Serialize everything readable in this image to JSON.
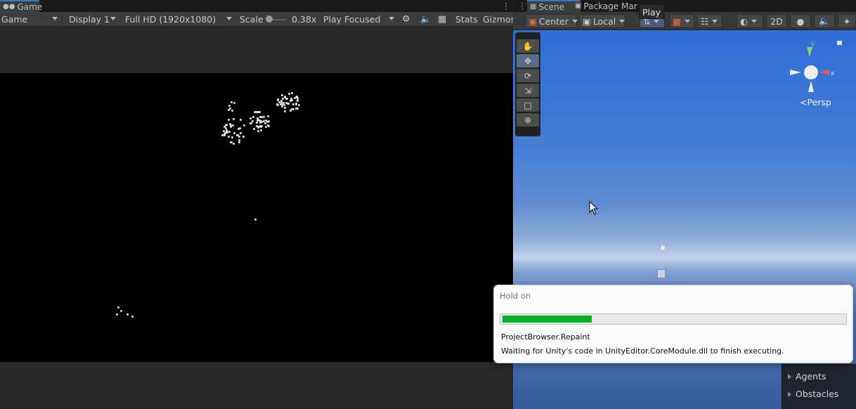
{
  "game_tab": {
    "title": "Game"
  },
  "game_toolbar": {
    "mode": "Game",
    "display": "Display 1",
    "resolution": "Full HD (1920x1080)",
    "scale_label": "Scale",
    "scale_value": "0.38x",
    "play_mode": "Play Focused",
    "stats": "Stats",
    "gizmos": "Gizmos"
  },
  "scene_tabs": {
    "scene": "Scene",
    "package_manager": "Package Mar"
  },
  "tooltip": {
    "text": "Play"
  },
  "scene_toolbar": {
    "pivot": "Center",
    "space": "Local",
    "mode_2d": "2D"
  },
  "scene_view": {
    "projection": "Persp",
    "gizmo_x": "x",
    "gizmo_y": "y"
  },
  "hierarchy_overlay": {
    "items": [
      "Agents",
      "Obstacles"
    ]
  },
  "dialog": {
    "title": "Hold on",
    "progress": 0.26,
    "line1": "ProjectBrowser.Repaint",
    "line2": "Waiting for Unity's code in UnityEditor.CoreModule.dll to finish executing."
  },
  "colors": {
    "progress_green": "#06b025",
    "active_tab_accent": "#3a79bb",
    "sky_blue": "#3f7ad7"
  }
}
